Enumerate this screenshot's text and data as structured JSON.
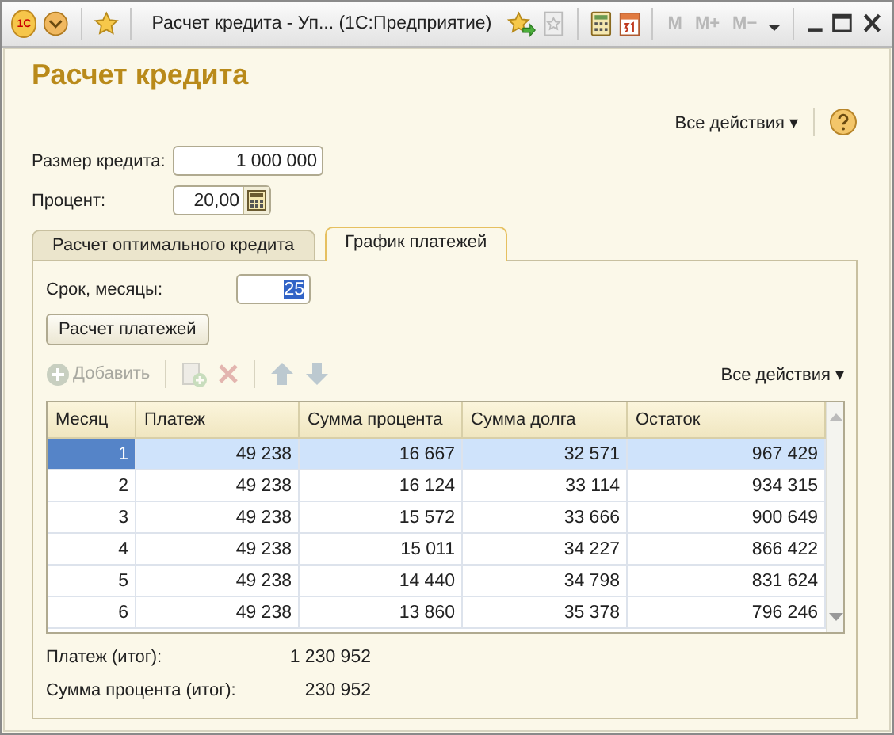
{
  "window": {
    "title": "Расчет кредита - Уп...  (1С:Предприятие)",
    "logo": "1С",
    "memory_buttons": [
      {
        "label": "M",
        "disabled": true
      },
      {
        "label": "M+",
        "disabled": true
      },
      {
        "label": "M−",
        "disabled": true
      }
    ]
  },
  "form": {
    "title": "Расчет кредита",
    "all_actions": "Все действия ▾",
    "fields": [
      {
        "label": "Размер кредита:",
        "value": "1 000 000",
        "kind": "plain"
      },
      {
        "label": "Процент:",
        "value": "20,00",
        "kind": "calculator"
      }
    ]
  },
  "tabs": [
    {
      "label": "Расчет оптимального кредита",
      "selected": false
    },
    {
      "label": "График платежей",
      "selected": true
    }
  ],
  "term": {
    "label": "Срок, месяцы:",
    "value": "25",
    "selected": true
  },
  "calc_button": "Расчет платежей",
  "toolbar": {
    "items": [
      {
        "kind": "add",
        "label": "Добавить",
        "disabled": true
      },
      {
        "kind": "copy",
        "disabled": true
      },
      {
        "kind": "delete",
        "disabled": true
      },
      {
        "kind": "up",
        "disabled": true
      },
      {
        "kind": "down",
        "disabled": true
      }
    ],
    "all_actions": "Все действия ▾"
  },
  "table": {
    "columns": [
      "Месяц",
      "Платеж",
      "Сумма процента",
      "Сумма долга",
      "Остаток"
    ],
    "rows": [
      {
        "cells": [
          "1",
          "49 238",
          "16 667",
          "32 571",
          "967 429"
        ],
        "selected": true
      },
      {
        "cells": [
          "2",
          "49 238",
          "16 124",
          "33 114",
          "934 315"
        ],
        "selected": false
      },
      {
        "cells": [
          "3",
          "49 238",
          "15 572",
          "33 666",
          "900 649"
        ],
        "selected": false
      },
      {
        "cells": [
          "4",
          "49 238",
          "15 011",
          "34 227",
          "866 422"
        ],
        "selected": false
      },
      {
        "cells": [
          "5",
          "49 238",
          "14 440",
          "34 798",
          "831 624"
        ],
        "selected": false
      },
      {
        "cells": [
          "6",
          "49 238",
          "13 860",
          "35 378",
          "796 246"
        ],
        "selected": false
      }
    ]
  },
  "totals": [
    {
      "label": "Платеж (итог):",
      "value": "1 230 952"
    },
    {
      "label": "Сумма процента (итог):",
      "value": "230 952"
    }
  ]
}
